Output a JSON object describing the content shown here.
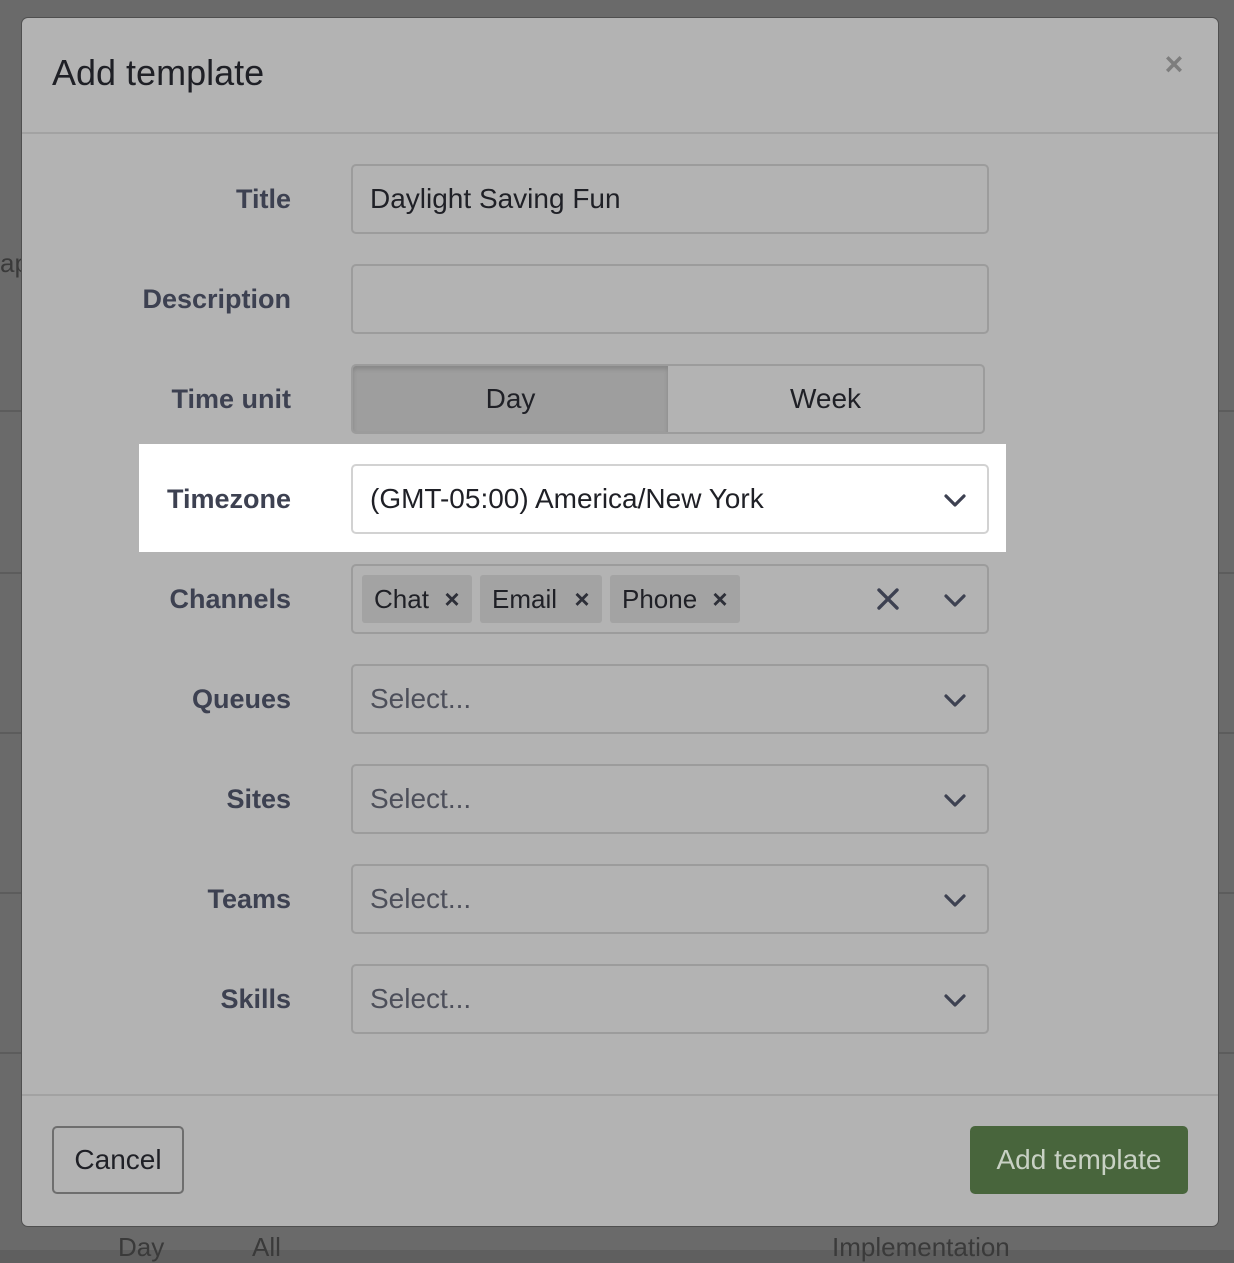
{
  "background": {
    "left_fragment": "ap",
    "bottom_row": {
      "col1": "Day",
      "col2": "All",
      "col3": "Implementation"
    }
  },
  "modal": {
    "title": "Add template",
    "close_icon": "close-icon"
  },
  "form": {
    "title": {
      "label": "Title",
      "value": "Daylight Saving Fun"
    },
    "description": {
      "label": "Description",
      "value": ""
    },
    "time_unit": {
      "label": "Time unit",
      "options": [
        "Day",
        "Week"
      ],
      "selected": "Day"
    },
    "timezone": {
      "label": "Timezone",
      "value": "(GMT-05:00) America/New York"
    },
    "channels": {
      "label": "Channels",
      "tags": [
        "Chat",
        "Email",
        "Phone"
      ]
    },
    "queues": {
      "label": "Queues",
      "placeholder": "Select..."
    },
    "sites": {
      "label": "Sites",
      "placeholder": "Select..."
    },
    "teams": {
      "label": "Teams",
      "placeholder": "Select..."
    },
    "skills": {
      "label": "Skills",
      "placeholder": "Select..."
    }
  },
  "footer": {
    "cancel_label": "Cancel",
    "submit_label": "Add template"
  },
  "colors": {
    "overlay": "#5f5f5f",
    "modal_bg": "#b3b3b3",
    "highlight": "#ffffff",
    "primary_button": "#48653c"
  }
}
